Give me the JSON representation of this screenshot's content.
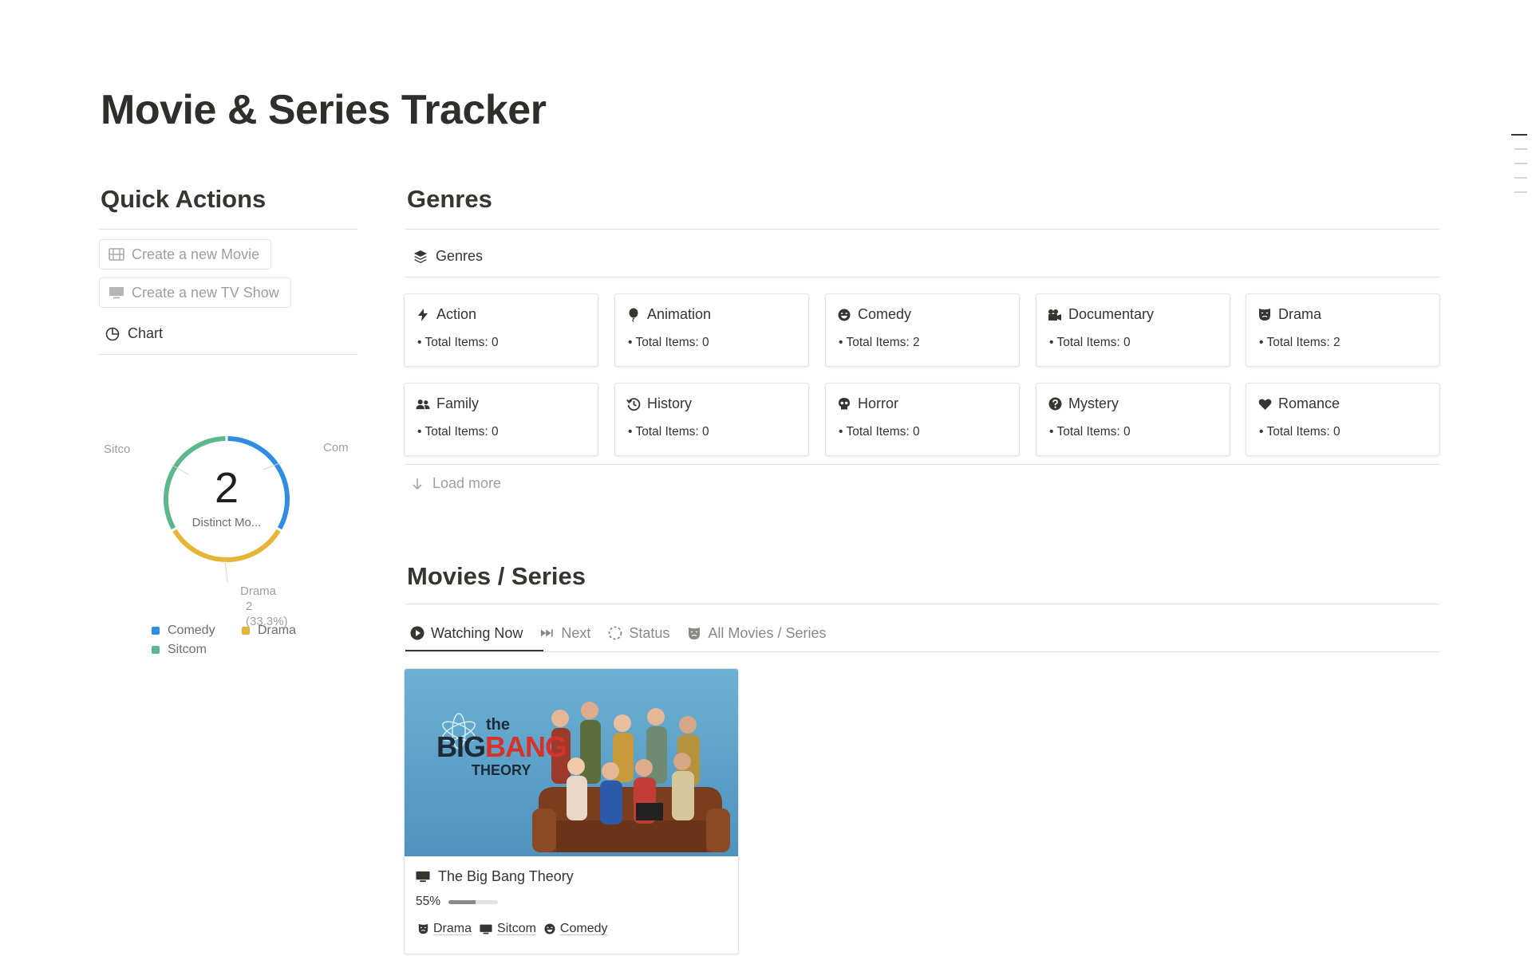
{
  "page": {
    "title": "Movie & Series Tracker"
  },
  "quick_actions": {
    "heading": "Quick Actions",
    "new_movie": "Create a new Movie",
    "new_tv_show": "Create a new TV Show",
    "chart_label": "Chart"
  },
  "chart_data": {
    "type": "pie",
    "style": "donut",
    "center_value": "2",
    "center_label": "Distinct Mo...",
    "slices": [
      {
        "name": "Comedy",
        "value": 2,
        "percent": 33.3,
        "color": "#2f8de4"
      },
      {
        "name": "Drama",
        "value": 2,
        "percent": 33.3,
        "color": "#e6b436"
      },
      {
        "name": "Sitcom",
        "value": 2,
        "percent": 33.3,
        "color": "#5cb88a"
      }
    ],
    "outer_labels": {
      "sitcom": "Sitco",
      "comedy": "Com",
      "drama_name": "Drama",
      "drama_value": "2",
      "drama_percent": "(33.3%)"
    },
    "legend": [
      "Comedy",
      "Drama",
      "Sitcom"
    ],
    "legend_placement": "bottom"
  },
  "genres": {
    "heading": "Genres",
    "view_label": "Genres",
    "load_more": "Load more",
    "items": [
      {
        "name": "Action",
        "total": "Total Items: 0",
        "icon": "bolt-icon"
      },
      {
        "name": "Animation",
        "total": "Total Items: 0",
        "icon": "balloon-icon"
      },
      {
        "name": "Comedy",
        "total": "Total Items: 2",
        "icon": "laughing-face-icon"
      },
      {
        "name": "Documentary",
        "total": "Total Items: 0",
        "icon": "movie-camera-icon"
      },
      {
        "name": "Drama",
        "total": "Total Items: 2",
        "icon": "theater-mask-icon"
      },
      {
        "name": "Family",
        "total": "Total Items: 0",
        "icon": "people-icon"
      },
      {
        "name": "History",
        "total": "Total Items: 0",
        "icon": "history-icon"
      },
      {
        "name": "Horror",
        "total": "Total Items: 0",
        "icon": "skull-icon"
      },
      {
        "name": "Mystery",
        "total": "Total Items: 0",
        "icon": "question-circle-icon"
      },
      {
        "name": "Romance",
        "total": "Total Items: 0",
        "icon": "heart-icon"
      }
    ]
  },
  "movies": {
    "heading": "Movies / Series",
    "tabs": [
      {
        "label": "Watching Now",
        "icon": "play-circle-icon",
        "active": true
      },
      {
        "label": "Next",
        "icon": "fast-forward-icon",
        "active": false
      },
      {
        "label": "Status",
        "icon": "loading-circle-icon",
        "active": false
      },
      {
        "label": "All Movies / Series",
        "icon": "theater-mask-icon",
        "active": false
      }
    ],
    "card": {
      "title": "The Big Bang Theory",
      "progress_text": "55%",
      "progress_value": 0.55,
      "poster_text": {
        "the": "the",
        "big": "BIG",
        "bang": "BANG",
        "theory": "THEORY"
      },
      "tags": [
        "Drama",
        "Sitcom",
        "Comedy"
      ]
    }
  },
  "colors": {
    "text": "#37352f",
    "muted": "#a09f9b",
    "comedy": "#2f8de4",
    "drama": "#e6b436",
    "sitcom": "#5cb88a",
    "poster_bg": "#5fa3c9",
    "poster_red": "#d8312a"
  }
}
